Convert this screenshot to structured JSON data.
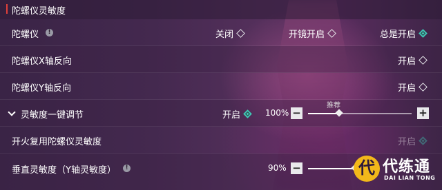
{
  "section": {
    "title": "陀螺仪灵敏度"
  },
  "rows": [
    {
      "label": "陀螺仪",
      "options": [
        {
          "label": "关闭",
          "checked": false
        },
        {
          "label": "开镜开启",
          "checked": false
        },
        {
          "label": "总是开启",
          "checked": true
        }
      ]
    },
    {
      "label": "陀螺仪X轴反向",
      "toggle": {
        "label": "开启",
        "checked": false
      }
    },
    {
      "label": "陀螺仪Y轴反向",
      "toggle": {
        "label": "开启",
        "checked": false
      }
    },
    {
      "label": "灵敏度一键调节",
      "toggle": {
        "label": "开启",
        "checked": true
      },
      "slider": {
        "value_text": "100%",
        "recommend_label": "推荐",
        "minus": "−",
        "plus": "+",
        "level": 0.3
      }
    },
    {
      "label": "开火复用陀螺仪灵敏度",
      "toggle": {
        "label": "开启",
        "checked": true,
        "disabled": true
      }
    },
    {
      "label": "垂直灵敏度（Y轴灵敏度）",
      "slider": {
        "value_text": "90%",
        "minus": "−",
        "level": 0.45
      }
    }
  ],
  "watermark": {
    "glyph": "代",
    "cn": "代练通",
    "en": "DAI LIAN TONG"
  },
  "colors": {
    "accent_check": "#41c7b7",
    "section_bar": "#e0403a",
    "logo_yellow": "#f2b81a"
  }
}
